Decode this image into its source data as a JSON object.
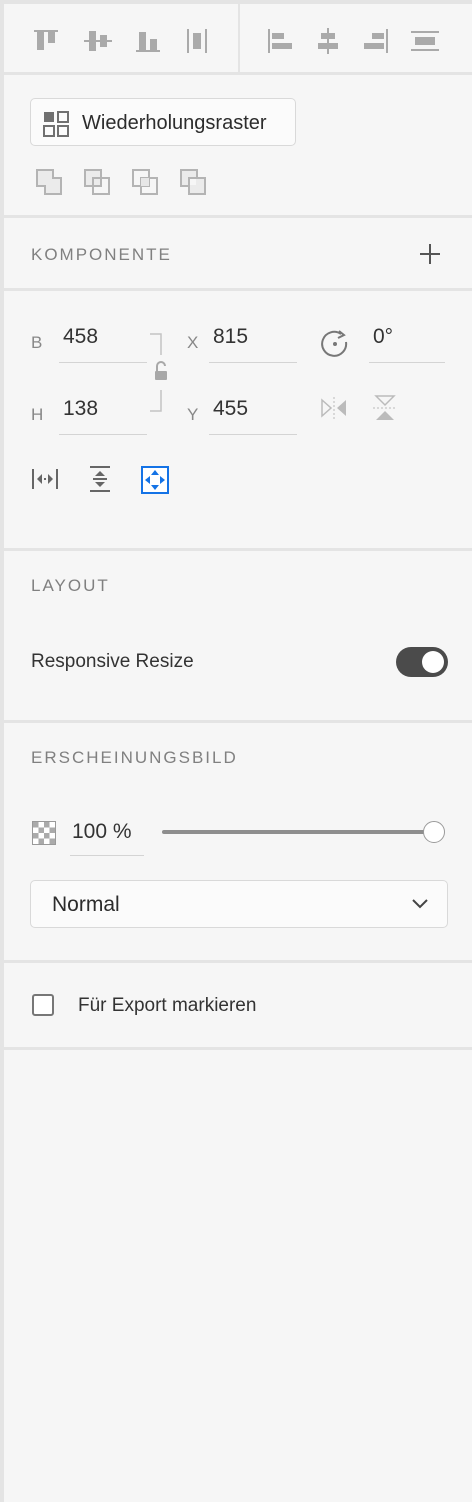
{
  "toolbar": {
    "align_icons": [
      "align-top-icon",
      "align-middle-icon",
      "align-bottom-icon",
      "distribute-vertical-icon",
      "align-left-icon",
      "align-center-icon",
      "align-right-icon",
      "distribute-horizontal-icon"
    ]
  },
  "repeat_grid": {
    "label": "Wiederholungsraster"
  },
  "component": {
    "title": "KOMPONENTE"
  },
  "transform": {
    "width_label": "B",
    "width_value": "458",
    "height_label": "H",
    "height_value": "138",
    "x_label": "X",
    "x_value": "815",
    "y_label": "Y",
    "y_value": "455",
    "rotation_value": "0°"
  },
  "layout": {
    "title": "LAYOUT",
    "responsive_label": "Responsive Resize",
    "responsive_enabled": true
  },
  "appearance": {
    "title": "ERSCHEINUNGSBILD",
    "opacity_value": "100 %",
    "opacity_fraction": 1.0,
    "blend_mode": "Normal"
  },
  "export": {
    "label": "Für Export markieren",
    "checked": false
  },
  "colors": {
    "accent": "#1473e6",
    "panel": "#f6f6f6",
    "divider": "#e4e4e4",
    "toggle_on": "#4b4b4b"
  }
}
